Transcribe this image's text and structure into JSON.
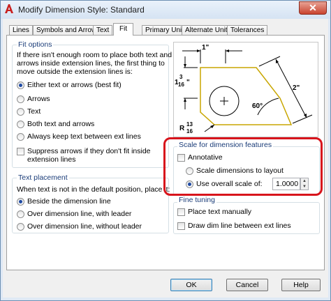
{
  "window": {
    "title": "Modify Dimension Style: Standard",
    "close_label": "✕"
  },
  "tabs": [
    {
      "label": "Lines",
      "active": false
    },
    {
      "label": "Symbols and Arrows",
      "active": false
    },
    {
      "label": "Text",
      "active": false
    },
    {
      "label": "Fit",
      "active": true
    },
    {
      "label": "Primary Units",
      "active": false
    },
    {
      "label": "Alternate Units",
      "active": false
    },
    {
      "label": "Tolerances",
      "active": false
    }
  ],
  "fit_options": {
    "legend": "Fit options",
    "description": [
      "If there isn't enough room to place both text and",
      "arrows inside extension lines, the first thing to",
      "move outside the extension lines is:"
    ],
    "options": [
      {
        "label": "Either text or arrows (best fit)",
        "selected": true
      },
      {
        "label": "Arrows",
        "selected": false
      },
      {
        "label": "Text",
        "selected": false
      },
      {
        "label": "Both text and arrows",
        "selected": false
      },
      {
        "label": "Always keep text between ext lines",
        "selected": false
      }
    ],
    "suppress_label_1": "Suppress arrows if they don't fit inside",
    "suppress_label_2": "extension lines",
    "suppress_checked": false
  },
  "text_placement": {
    "legend": "Text placement",
    "description": "When text is not in the default position, place it:",
    "options": [
      {
        "label": "Beside the dimension line",
        "selected": true
      },
      {
        "label": "Over dimension line, with leader",
        "selected": false
      },
      {
        "label": "Over dimension line, without leader",
        "selected": false
      }
    ]
  },
  "preview": {
    "dim_top": "1\"",
    "dim_left_whole": "1",
    "dim_left_num": "3",
    "dim_left_den": "16",
    "dim_left_unit": "\"",
    "dim_right": "2\"",
    "dim_angle": "60°",
    "radius_prefix": "R",
    "radius_num": "13",
    "radius_den": "16"
  },
  "scale": {
    "legend": "Scale for dimension features",
    "annotative_label": "Annotative",
    "annotative_checked": false,
    "layout_label": "Scale dimensions to layout",
    "layout_selected": false,
    "overall_label": "Use overall scale of:",
    "overall_selected": true,
    "overall_value": "1.0000"
  },
  "fine_tuning": {
    "legend": "Fine tuning",
    "manual_label": "Place text manually",
    "manual_checked": false,
    "draw_label": "Draw dim line between ext lines",
    "draw_checked": false
  },
  "buttons": {
    "ok": "OK",
    "cancel": "Cancel",
    "help": "Help"
  },
  "colors": {
    "accent": "#1f4aa3",
    "highlight": "#d8141c",
    "legend_text": "#1a3c78",
    "drawing_outline": "#c8a600"
  }
}
